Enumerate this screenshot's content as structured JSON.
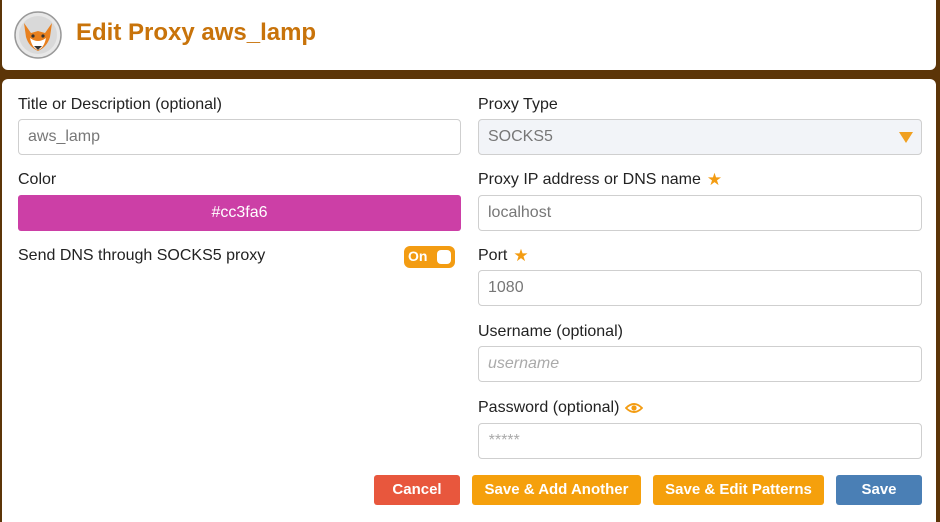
{
  "header": {
    "title": "Edit Proxy aws_lamp",
    "logo_icon": "fox-logo-icon"
  },
  "left": {
    "title_label": "Title or Description (optional)",
    "title_value": "aws_lamp",
    "color_label": "Color",
    "color_value": "#cc3fa6",
    "dns_label": "Send DNS through SOCKS5 proxy",
    "dns_toggle_text": "On",
    "dns_toggle_state": true
  },
  "right": {
    "proxy_type_label": "Proxy Type",
    "proxy_type_value": "SOCKS5",
    "ip_label": "Proxy IP address or DNS name",
    "ip_value": "localhost",
    "port_label": "Port",
    "port_value": "1080",
    "username_label": "Username (optional)",
    "username_placeholder": "username",
    "password_label": "Password (optional)",
    "password_placeholder": "*****"
  },
  "buttons": {
    "cancel": "Cancel",
    "save_add": "Save & Add Another",
    "save_edit": "Save & Edit Patterns",
    "save": "Save"
  },
  "colors": {
    "accent": "#f39c12",
    "title": "#c8730a",
    "frame": "#5c3508",
    "cancel": "#e8573d",
    "save": "#4a7fb5"
  }
}
